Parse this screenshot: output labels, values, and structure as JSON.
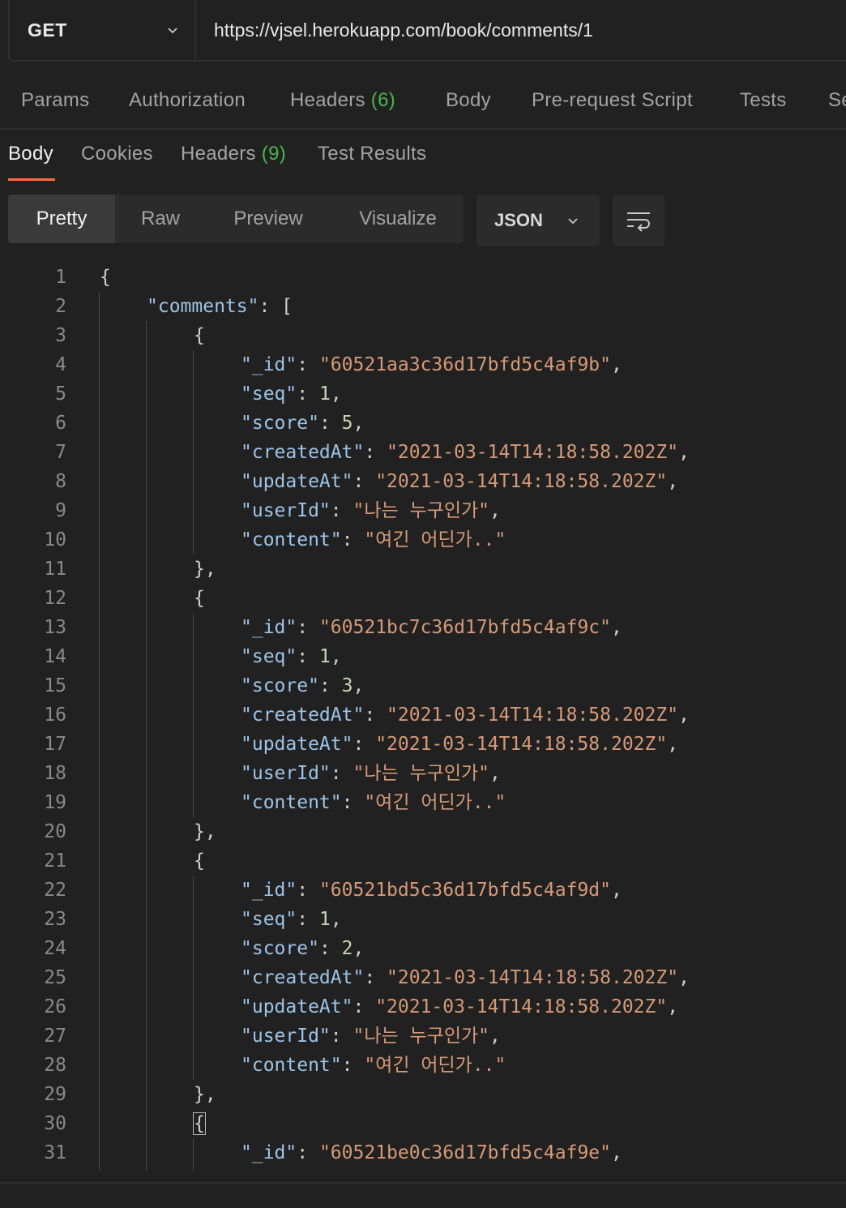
{
  "request": {
    "method": "GET",
    "url": "https://vjsel.herokuapp.com/book/comments/1"
  },
  "request_tabs": [
    {
      "label": "Params"
    },
    {
      "label": "Authorization"
    },
    {
      "label": "Headers",
      "count": "(6)"
    },
    {
      "label": "Body"
    },
    {
      "label": "Pre-request Script"
    },
    {
      "label": "Tests"
    },
    {
      "label": "Se"
    }
  ],
  "response_tabs": [
    {
      "label": "Body",
      "active": true
    },
    {
      "label": "Cookies"
    },
    {
      "label": "Headers",
      "count": "(9)"
    },
    {
      "label": "Test Results"
    }
  ],
  "view_modes": [
    {
      "label": "Pretty",
      "active": true
    },
    {
      "label": "Raw"
    },
    {
      "label": "Preview"
    },
    {
      "label": "Visualize"
    }
  ],
  "format_select": {
    "value": "JSON"
  },
  "colors": {
    "background": "#212121",
    "accent": "#ff6c37",
    "count_green": "#4fb34f",
    "json_key": "#9cc4e8",
    "json_string": "#d69a78",
    "json_number": "#c6d8b2"
  },
  "code_lines": [
    {
      "n": "1",
      "indent": 0,
      "parts": [
        [
          "p",
          "{"
        ]
      ]
    },
    {
      "n": "2",
      "indent": 1,
      "parts": [
        [
          "k",
          "\"comments\""
        ],
        [
          "p",
          ": ["
        ]
      ]
    },
    {
      "n": "3",
      "indent": 2,
      "parts": [
        [
          "p",
          "{"
        ]
      ]
    },
    {
      "n": "4",
      "indent": 3,
      "parts": [
        [
          "k",
          "\"_id\""
        ],
        [
          "p",
          ": "
        ],
        [
          "s",
          "\"60521aa3c36d17bfd5c4af9b\""
        ],
        [
          "p",
          ","
        ]
      ]
    },
    {
      "n": "5",
      "indent": 3,
      "parts": [
        [
          "k",
          "\"seq\""
        ],
        [
          "p",
          ": "
        ],
        [
          "n",
          "1"
        ],
        [
          "p",
          ","
        ]
      ]
    },
    {
      "n": "6",
      "indent": 3,
      "parts": [
        [
          "k",
          "\"score\""
        ],
        [
          "p",
          ": "
        ],
        [
          "n",
          "5"
        ],
        [
          "p",
          ","
        ]
      ]
    },
    {
      "n": "7",
      "indent": 3,
      "parts": [
        [
          "k",
          "\"createdAt\""
        ],
        [
          "p",
          ": "
        ],
        [
          "s",
          "\"2021-03-14T14:18:58.202Z\""
        ],
        [
          "p",
          ","
        ]
      ]
    },
    {
      "n": "8",
      "indent": 3,
      "parts": [
        [
          "k",
          "\"updateAt\""
        ],
        [
          "p",
          ": "
        ],
        [
          "s",
          "\"2021-03-14T14:18:58.202Z\""
        ],
        [
          "p",
          ","
        ]
      ]
    },
    {
      "n": "9",
      "indent": 3,
      "parts": [
        [
          "k",
          "\"userId\""
        ],
        [
          "p",
          ": "
        ],
        [
          "s",
          "\"나는 누구인가\""
        ],
        [
          "p",
          ","
        ]
      ]
    },
    {
      "n": "10",
      "indent": 3,
      "parts": [
        [
          "k",
          "\"content\""
        ],
        [
          "p",
          ": "
        ],
        [
          "s",
          "\"여긴 어딘가..\""
        ]
      ]
    },
    {
      "n": "11",
      "indent": 2,
      "parts": [
        [
          "p",
          "},"
        ]
      ]
    },
    {
      "n": "12",
      "indent": 2,
      "parts": [
        [
          "p",
          "{"
        ]
      ]
    },
    {
      "n": "13",
      "indent": 3,
      "parts": [
        [
          "k",
          "\"_id\""
        ],
        [
          "p",
          ": "
        ],
        [
          "s",
          "\"60521bc7c36d17bfd5c4af9c\""
        ],
        [
          "p",
          ","
        ]
      ]
    },
    {
      "n": "14",
      "indent": 3,
      "parts": [
        [
          "k",
          "\"seq\""
        ],
        [
          "p",
          ": "
        ],
        [
          "n",
          "1"
        ],
        [
          "p",
          ","
        ]
      ]
    },
    {
      "n": "15",
      "indent": 3,
      "parts": [
        [
          "k",
          "\"score\""
        ],
        [
          "p",
          ": "
        ],
        [
          "n",
          "3"
        ],
        [
          "p",
          ","
        ]
      ]
    },
    {
      "n": "16",
      "indent": 3,
      "parts": [
        [
          "k",
          "\"createdAt\""
        ],
        [
          "p",
          ": "
        ],
        [
          "s",
          "\"2021-03-14T14:18:58.202Z\""
        ],
        [
          "p",
          ","
        ]
      ]
    },
    {
      "n": "17",
      "indent": 3,
      "parts": [
        [
          "k",
          "\"updateAt\""
        ],
        [
          "p",
          ": "
        ],
        [
          "s",
          "\"2021-03-14T14:18:58.202Z\""
        ],
        [
          "p",
          ","
        ]
      ]
    },
    {
      "n": "18",
      "indent": 3,
      "parts": [
        [
          "k",
          "\"userId\""
        ],
        [
          "p",
          ": "
        ],
        [
          "s",
          "\"나는 누구인가\""
        ],
        [
          "p",
          ","
        ]
      ]
    },
    {
      "n": "19",
      "indent": 3,
      "parts": [
        [
          "k",
          "\"content\""
        ],
        [
          "p",
          ": "
        ],
        [
          "s",
          "\"여긴 어딘가..\""
        ]
      ]
    },
    {
      "n": "20",
      "indent": 2,
      "parts": [
        [
          "p",
          "},"
        ]
      ]
    },
    {
      "n": "21",
      "indent": 2,
      "parts": [
        [
          "p",
          "{"
        ]
      ]
    },
    {
      "n": "22",
      "indent": 3,
      "parts": [
        [
          "k",
          "\"_id\""
        ],
        [
          "p",
          ": "
        ],
        [
          "s",
          "\"60521bd5c36d17bfd5c4af9d\""
        ],
        [
          "p",
          ","
        ]
      ]
    },
    {
      "n": "23",
      "indent": 3,
      "parts": [
        [
          "k",
          "\"seq\""
        ],
        [
          "p",
          ": "
        ],
        [
          "n",
          "1"
        ],
        [
          "p",
          ","
        ]
      ]
    },
    {
      "n": "24",
      "indent": 3,
      "parts": [
        [
          "k",
          "\"score\""
        ],
        [
          "p",
          ": "
        ],
        [
          "n",
          "2"
        ],
        [
          "p",
          ","
        ]
      ]
    },
    {
      "n": "25",
      "indent": 3,
      "parts": [
        [
          "k",
          "\"createdAt\""
        ],
        [
          "p",
          ": "
        ],
        [
          "s",
          "\"2021-03-14T14:18:58.202Z\""
        ],
        [
          "p",
          ","
        ]
      ]
    },
    {
      "n": "26",
      "indent": 3,
      "parts": [
        [
          "k",
          "\"updateAt\""
        ],
        [
          "p",
          ": "
        ],
        [
          "s",
          "\"2021-03-14T14:18:58.202Z\""
        ],
        [
          "p",
          ","
        ]
      ]
    },
    {
      "n": "27",
      "indent": 3,
      "parts": [
        [
          "k",
          "\"userId\""
        ],
        [
          "p",
          ": "
        ],
        [
          "s",
          "\"나는 누구인가\""
        ],
        [
          "p",
          ","
        ]
      ]
    },
    {
      "n": "28",
      "indent": 3,
      "parts": [
        [
          "k",
          "\"content\""
        ],
        [
          "p",
          ": "
        ],
        [
          "s",
          "\"여긴 어딘가..\""
        ]
      ]
    },
    {
      "n": "29",
      "indent": 2,
      "parts": [
        [
          "p",
          "},"
        ]
      ]
    },
    {
      "n": "30",
      "indent": 2,
      "parts": [
        [
          "c",
          "{"
        ]
      ]
    },
    {
      "n": "31",
      "indent": 3,
      "parts": [
        [
          "k",
          "\"_id\""
        ],
        [
          "p",
          ": "
        ],
        [
          "s",
          "\"60521be0c36d17bfd5c4af9e\""
        ],
        [
          "p",
          ","
        ]
      ]
    }
  ]
}
